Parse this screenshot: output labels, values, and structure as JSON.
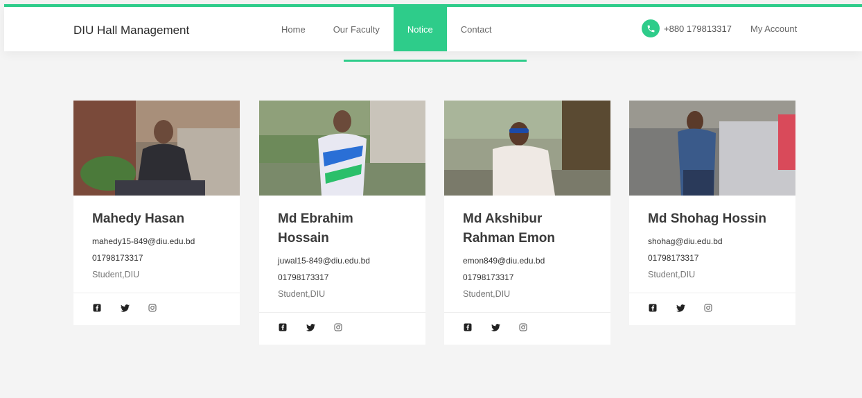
{
  "header": {
    "brand": "DIU Hall Management",
    "nav": [
      "Home",
      "Our Faculty",
      "Notice",
      "Contact"
    ],
    "active_nav": "Notice",
    "phone": "+880 179813317",
    "account": "My Account"
  },
  "colors": {
    "accent": "#2ecc8a"
  },
  "cards": [
    {
      "name": "Mahedy Hasan",
      "email": "mahedy15-849@diu.edu.bd",
      "phone": "01798173317",
      "role": "Student,DIU",
      "social": [
        "facebook-icon",
        "twitter-icon",
        "instagram-icon"
      ]
    },
    {
      "name": "Md Ebrahim Hossain",
      "email": "juwal15-849@diu.edu.bd",
      "phone": "01798173317",
      "role": "Student,DIU",
      "social": [
        "facebook-icon",
        "twitter-icon",
        "instagram-icon"
      ]
    },
    {
      "name": "Md Akshibur Rahman Emon",
      "email": "emon849@diu.edu.bd",
      "phone": "01798173317",
      "role": "Student,DIU",
      "social": [
        "facebook-icon",
        "twitter-icon",
        "instagram-icon"
      ]
    },
    {
      "name": "Md Shohag Hossin",
      "email": "shohag@diu.edu.bd",
      "phone": "01798173317",
      "role": "Student,DIU",
      "social": [
        "facebook-icon",
        "twitter-icon",
        "instagram-icon"
      ]
    }
  ]
}
